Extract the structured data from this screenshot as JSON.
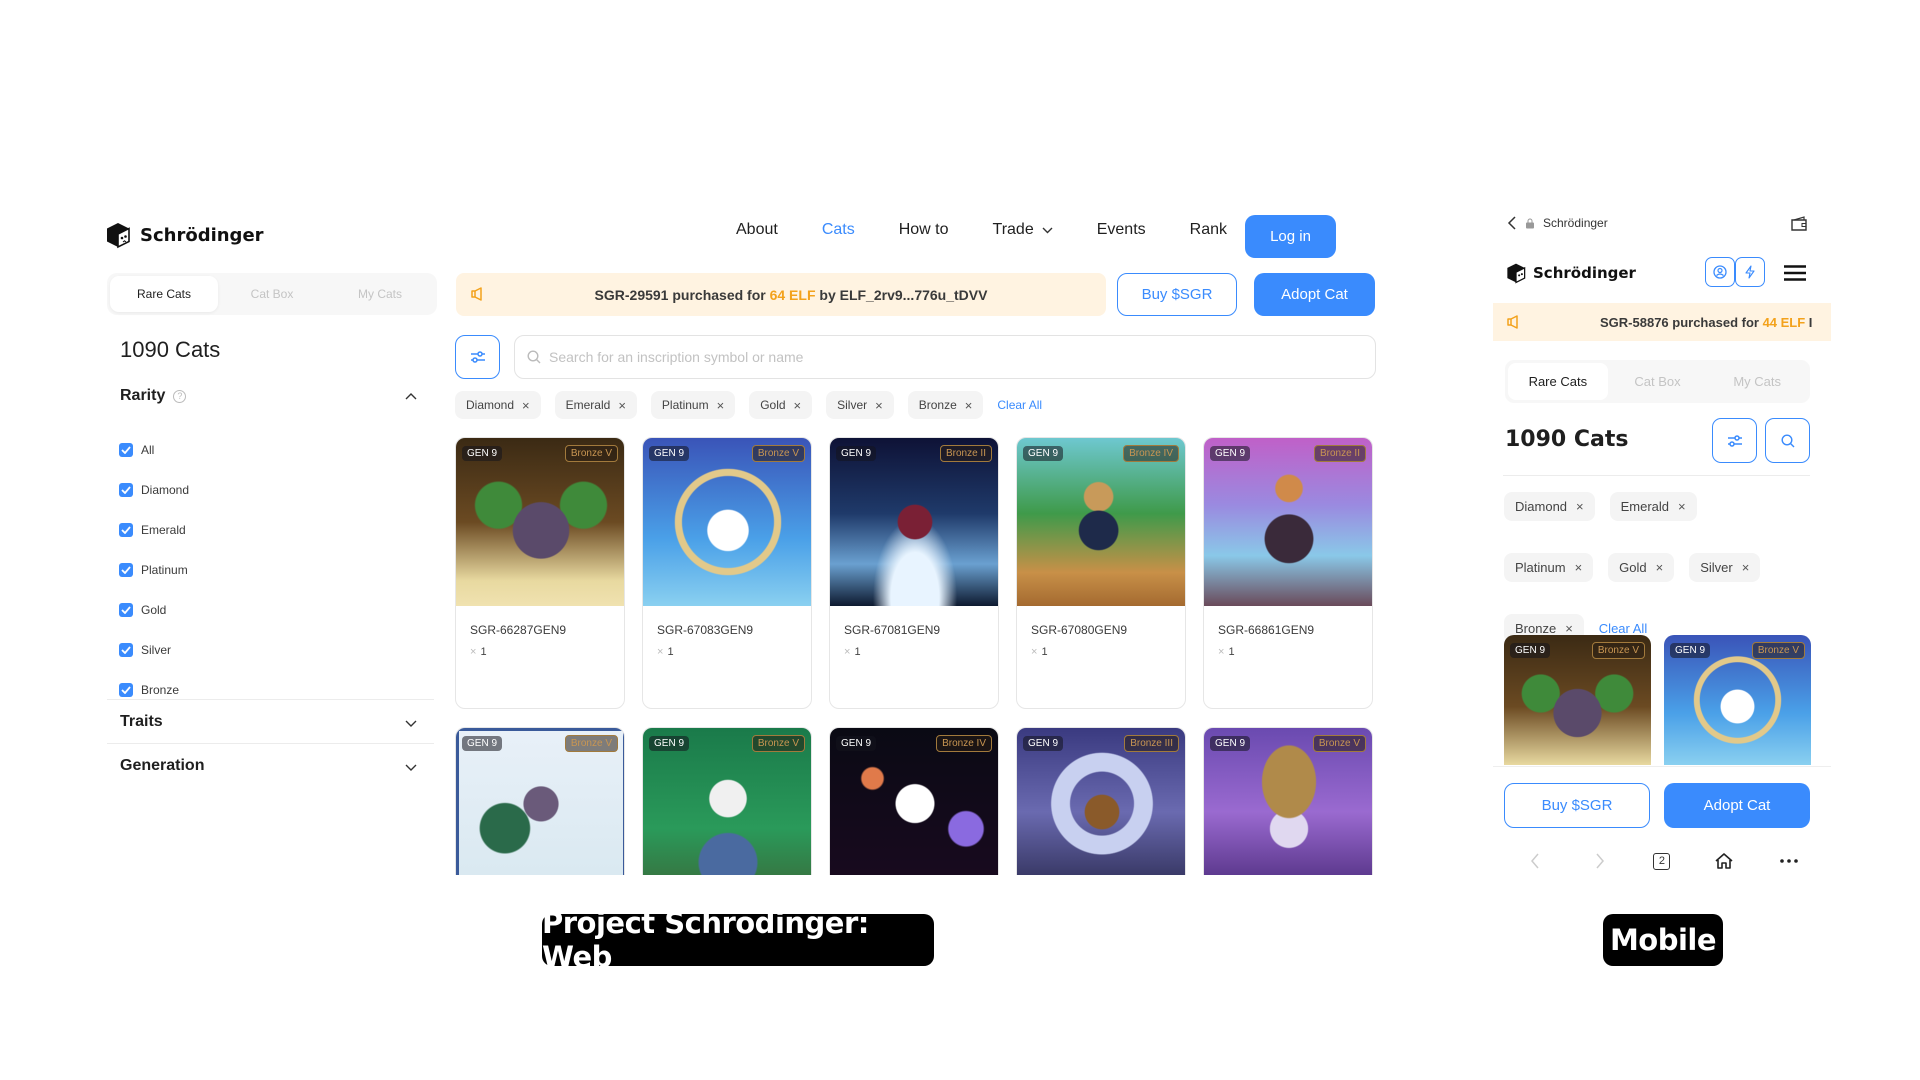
{
  "web": {
    "brand": "Schrödinger",
    "nav": [
      {
        "label": "About",
        "active": false
      },
      {
        "label": "Cats",
        "active": true
      },
      {
        "label": "How to",
        "active": false
      },
      {
        "label": "Trade",
        "active": false,
        "dropdown": true
      },
      {
        "label": "Events",
        "active": false
      },
      {
        "label": "Rank",
        "active": false
      }
    ],
    "login_label": "Log in",
    "tabs": [
      {
        "label": "Rare Cats",
        "active": true
      },
      {
        "label": "Cat Box",
        "active": false
      },
      {
        "label": "My Cats",
        "active": false
      }
    ],
    "ticker": {
      "prefix": "SGR-29591 purchased for ",
      "amount": "64 ELF",
      "suffix": " by ELF_2rv9...776u_tDVV"
    },
    "buy_label": "Buy $SGR",
    "adopt_label": "Adopt Cat",
    "count_label": "1090 Cats",
    "rarity": {
      "title": "Rarity",
      "help": "?",
      "options": [
        {
          "label": "All",
          "checked": true
        },
        {
          "label": "Diamond",
          "checked": true
        },
        {
          "label": "Emerald",
          "checked": true
        },
        {
          "label": "Platinum",
          "checked": true
        },
        {
          "label": "Gold",
          "checked": true
        },
        {
          "label": "Silver",
          "checked": true
        },
        {
          "label": "Bronze",
          "checked": true
        }
      ]
    },
    "traits_title": "Traits",
    "generation_title": "Generation",
    "search": {
      "placeholder": "Search for an inscription symbol or name",
      "value": ""
    },
    "chips": [
      "Diamond",
      "Emerald",
      "Platinum",
      "Gold",
      "Silver",
      "Bronze"
    ],
    "chip_remove": "×",
    "clear_all": "Clear All",
    "cards": [
      {
        "gen": "GEN 9",
        "rarity": "Bronze V",
        "name": "SGR-66287GEN9",
        "qty_symbol": "×",
        "qty": "1"
      },
      {
        "gen": "GEN 9",
        "rarity": "Bronze V",
        "name": "SGR-67083GEN9",
        "qty_symbol": "×",
        "qty": "1"
      },
      {
        "gen": "GEN 9",
        "rarity": "Bronze II",
        "name": "SGR-67081GEN9",
        "qty_symbol": "×",
        "qty": "1"
      },
      {
        "gen": "GEN 9",
        "rarity": "Bronze IV",
        "name": "SGR-67080GEN9",
        "qty_symbol": "×",
        "qty": "1"
      },
      {
        "gen": "GEN 9",
        "rarity": "Bronze II",
        "name": "SGR-66861GEN9",
        "qty_symbol": "×",
        "qty": "1"
      },
      {
        "gen": "GEN 9",
        "rarity": "Bronze V"
      },
      {
        "gen": "GEN 9",
        "rarity": "Bronze V"
      },
      {
        "gen": "GEN 9",
        "rarity": "Bronze IV"
      },
      {
        "gen": "GEN 9",
        "rarity": "Bronze III"
      },
      {
        "gen": "GEN 9",
        "rarity": "Bronze V"
      }
    ]
  },
  "mobile": {
    "browser_title": "Schrödinger",
    "brand": "Schrödinger",
    "ticker": {
      "prefix": "SGR-58876 purchased for ",
      "amount": "44 ELF",
      "suffix": " I"
    },
    "tabs": [
      {
        "label": "Rare Cats",
        "active": true
      },
      {
        "label": "Cat Box",
        "active": false
      },
      {
        "label": "My Cats",
        "active": false
      }
    ],
    "count_label": "1090 Cats",
    "chips": [
      "Diamond",
      "Emerald",
      "Platinum",
      "Gold",
      "Silver",
      "Bronze"
    ],
    "chip_remove": "×",
    "clear_all": "Clear All",
    "cards": [
      {
        "gen": "GEN 9",
        "rarity": "Bronze V"
      },
      {
        "gen": "GEN 9",
        "rarity": "Bronze V"
      }
    ],
    "buy_label": "Buy $SGR",
    "adopt_label": "Adopt Cat",
    "tab_count": "2"
  },
  "labels": {
    "web": "Project Schrodinger: Web",
    "mobile": "Mobile"
  },
  "colors": {
    "accent": "#3a8bfd",
    "ticker_bg": "#fff3e1",
    "ticker_highlight": "#f3a21c",
    "rarity_badge": "#c99652"
  }
}
